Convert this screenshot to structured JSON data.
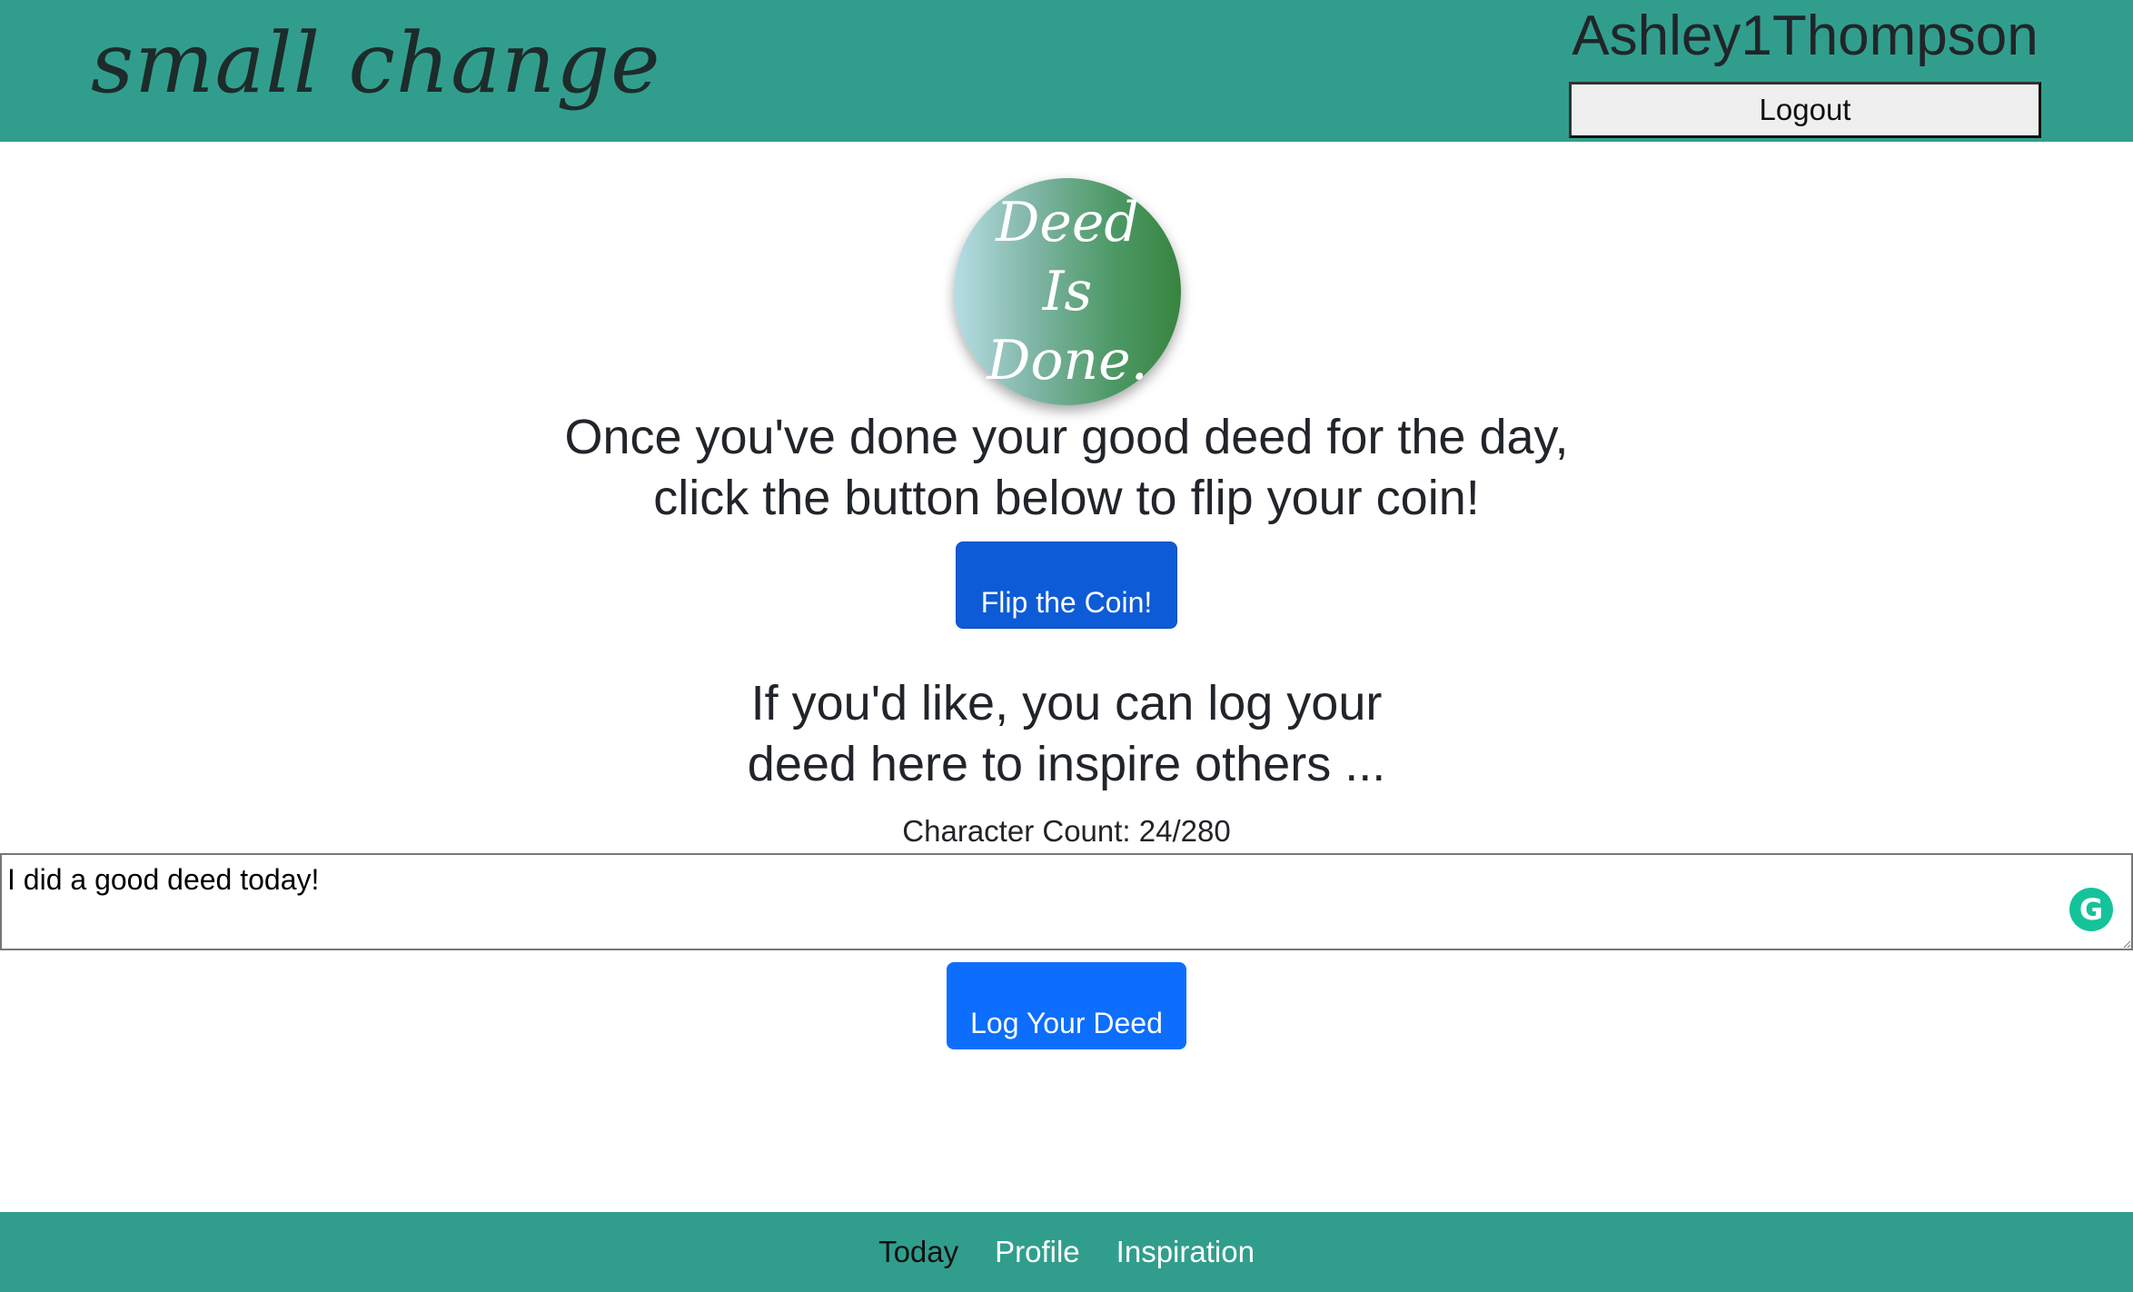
{
  "header": {
    "brand": "small change",
    "username": "Ashley1Thompson",
    "logout_label": "Logout"
  },
  "coin": {
    "line1": "Deed",
    "line2": "Is",
    "line3": "Done."
  },
  "main": {
    "prompt_line1": "Once you've done your good deed for the day,",
    "prompt_line2": "click the button below to flip your coin!",
    "flip_button": "Flip the Coin!",
    "log_prompt_line1": "If you'd like, you can log your",
    "log_prompt_line2": "deed here to inspire others ...",
    "char_count": "Character Count: 24/280",
    "deed_value": "I did a good deed today!",
    "log_button": "Log Your Deed"
  },
  "footer": {
    "links": [
      "Today",
      "Profile",
      "Inspiration"
    ],
    "active": "Today"
  },
  "colors": {
    "header_bg": "#319e8d",
    "primary_button": "#0d6efd",
    "grammarly": "#15c39a"
  }
}
